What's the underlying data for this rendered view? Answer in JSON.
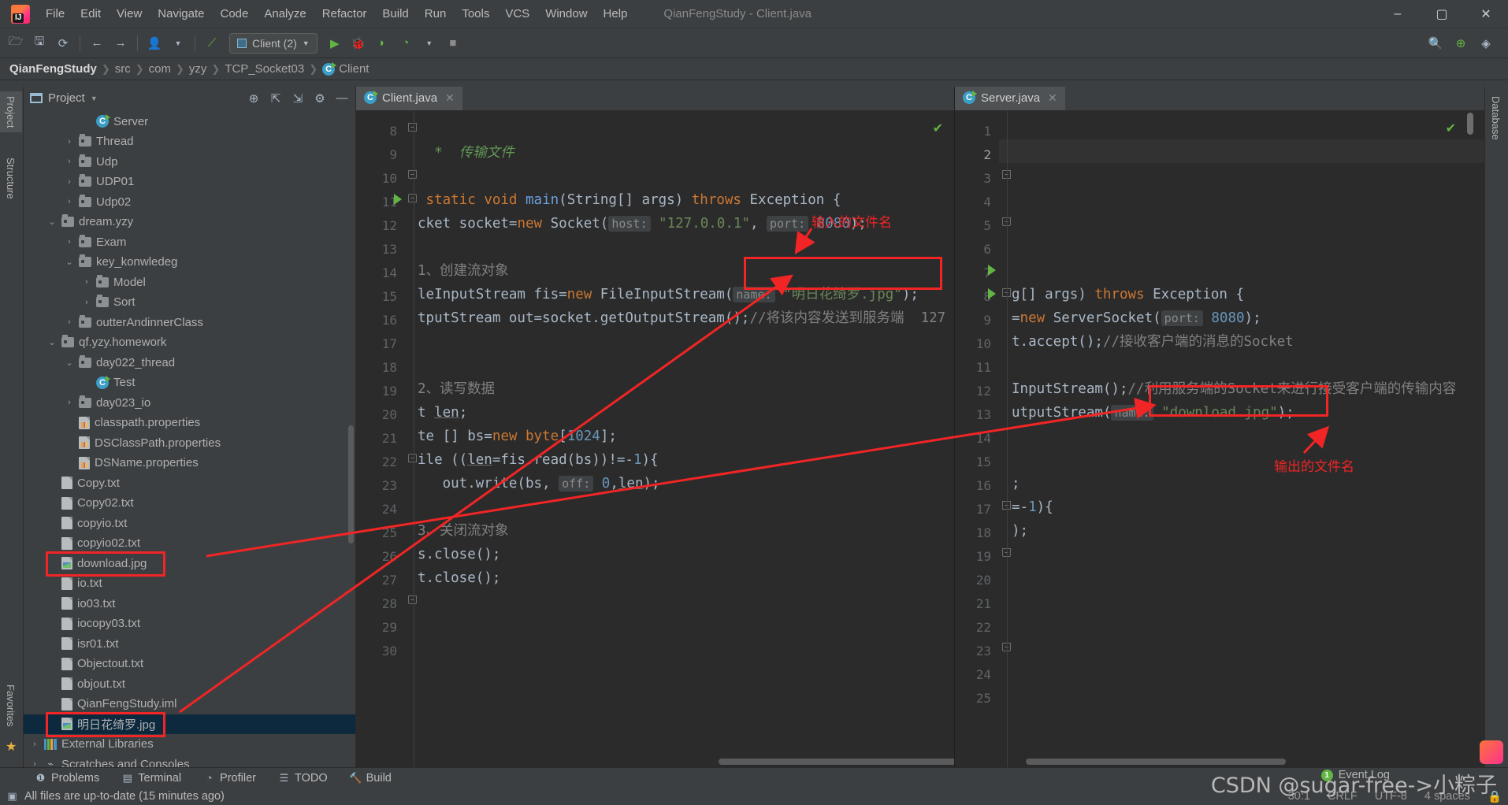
{
  "window": {
    "title": "QianFengStudy - Client.java",
    "minimize": "–",
    "maximize": "▢",
    "close": "✕"
  },
  "menu": {
    "items": [
      "File",
      "Edit",
      "View",
      "Navigate",
      "Code",
      "Analyze",
      "Refactor",
      "Build",
      "Run",
      "Tools",
      "VCS",
      "Window",
      "Help"
    ]
  },
  "toolbar": {
    "run_config": "Client (2)",
    "icons": [
      "open-folder-icon",
      "save-all-icon",
      "sync-icon",
      "back-icon",
      "forward-icon",
      "vcs-update-icon",
      "dropdown-icon",
      "make-project-icon",
      "run-icon",
      "debug-icon",
      "run-coverage-icon",
      "profiler-icon",
      "stop-icon",
      "search-everywhere-icon",
      "plugin-icon",
      "ide-icon"
    ]
  },
  "breadcrumb": {
    "items": [
      "QianFengStudy",
      "src",
      "com",
      "yzy",
      "TCP_Socket03",
      "Client"
    ],
    "separator": "❯"
  },
  "left_strip": {
    "tabs": [
      "Project",
      "Structure"
    ],
    "bottom": [
      "Favorites"
    ]
  },
  "right_strip": {
    "tabs": [
      "Database"
    ]
  },
  "project_panel": {
    "title": "Project",
    "header_icons": [
      "locate-icon",
      "expand-all-icon",
      "collapse-all-icon",
      "settings-icon",
      "hide-icon"
    ],
    "tree": [
      {
        "label": "Server",
        "indent": 3,
        "icon": "class-icon",
        "arrow": ""
      },
      {
        "label": "Thread",
        "indent": 2,
        "icon": "folder-icon",
        "arrow": "›"
      },
      {
        "label": "Udp",
        "indent": 2,
        "icon": "folder-icon",
        "arrow": "›"
      },
      {
        "label": "UDP01",
        "indent": 2,
        "icon": "folder-icon",
        "arrow": "›"
      },
      {
        "label": "Udp02",
        "indent": 2,
        "icon": "folder-icon",
        "arrow": "›"
      },
      {
        "label": "dream.yzy",
        "indent": 1,
        "icon": "folder-icon",
        "arrow": "⌄"
      },
      {
        "label": "Exam",
        "indent": 2,
        "icon": "folder-icon",
        "arrow": "›"
      },
      {
        "label": "key_konwledeg",
        "indent": 2,
        "icon": "folder-icon",
        "arrow": "⌄"
      },
      {
        "label": "Model",
        "indent": 3,
        "icon": "folder-icon",
        "arrow": "›"
      },
      {
        "label": "Sort",
        "indent": 3,
        "icon": "folder-icon",
        "arrow": "›"
      },
      {
        "label": "outterAndinnerClass",
        "indent": 2,
        "icon": "folder-icon",
        "arrow": "›"
      },
      {
        "label": "qf.yzy.homework",
        "indent": 1,
        "icon": "folder-icon",
        "arrow": "⌄"
      },
      {
        "label": "day022_thread",
        "indent": 2,
        "icon": "folder-icon",
        "arrow": "⌄"
      },
      {
        "label": "Test",
        "indent": 3,
        "icon": "class-icon",
        "arrow": ""
      },
      {
        "label": "day023_io",
        "indent": 2,
        "icon": "folder-icon",
        "arrow": "›"
      },
      {
        "label": "classpath.properties",
        "indent": 2,
        "icon": "properties-icon",
        "arrow": ""
      },
      {
        "label": "DSClassPath.properties",
        "indent": 2,
        "icon": "properties-icon",
        "arrow": ""
      },
      {
        "label": "DSName.properties",
        "indent": 2,
        "icon": "properties-icon",
        "arrow": ""
      },
      {
        "label": "Copy.txt",
        "indent": 1,
        "icon": "text-file-icon",
        "arrow": ""
      },
      {
        "label": "Copy02.txt",
        "indent": 1,
        "icon": "text-file-icon",
        "arrow": ""
      },
      {
        "label": "copyio.txt",
        "indent": 1,
        "icon": "text-file-icon",
        "arrow": ""
      },
      {
        "label": "copyio02.txt",
        "indent": 1,
        "icon": "text-file-icon",
        "arrow": ""
      },
      {
        "label": "download.jpg",
        "indent": 1,
        "icon": "image-file-icon",
        "arrow": "",
        "highlight": true
      },
      {
        "label": "io.txt",
        "indent": 1,
        "icon": "text-file-icon",
        "arrow": ""
      },
      {
        "label": "io03.txt",
        "indent": 1,
        "icon": "text-file-icon",
        "arrow": ""
      },
      {
        "label": "iocopy03.txt",
        "indent": 1,
        "icon": "text-file-icon",
        "arrow": ""
      },
      {
        "label": "isr01.txt",
        "indent": 1,
        "icon": "text-file-icon",
        "arrow": ""
      },
      {
        "label": "Objectout.txt",
        "indent": 1,
        "icon": "text-file-icon",
        "arrow": ""
      },
      {
        "label": "objout.txt",
        "indent": 1,
        "icon": "text-file-icon",
        "arrow": ""
      },
      {
        "label": "QianFengStudy.iml",
        "indent": 1,
        "icon": "module-file-icon",
        "arrow": ""
      },
      {
        "label": "明日花绮罗.jpg",
        "indent": 1,
        "icon": "image-file-icon",
        "arrow": "",
        "selected": true,
        "highlight": true
      },
      {
        "label": "External Libraries",
        "indent": 0,
        "icon": "library-icon",
        "arrow": "›"
      },
      {
        "label": "Scratches and Consoles",
        "indent": 0,
        "icon": "scratches-icon",
        "arrow": "›"
      }
    ]
  },
  "editor_left": {
    "tab": {
      "label": "Client.java",
      "icon": "class-icon",
      "close": "✕"
    },
    "lines": [
      {
        "n": 8,
        "text": "",
        "fold": "mid"
      },
      {
        "n": 9,
        "segs": [
          {
            "t": "  *  传输文件",
            "c": "cmt-doc"
          }
        ]
      },
      {
        "n": 10,
        "text": "",
        "fold": "end"
      },
      {
        "n": 11,
        "run": true,
        "fold": "start",
        "segs": [
          {
            "t": " ",
            "c": "plain"
          },
          {
            "t": "static",
            "c": "kw"
          },
          {
            "t": " ",
            "c": "plain"
          },
          {
            "t": "void",
            "c": "kw"
          },
          {
            "t": " ",
            "c": "plain"
          },
          {
            "t": "main",
            "c": "kw2"
          },
          {
            "t": "(String[] args) ",
            "c": "plain"
          },
          {
            "t": "throws",
            "c": "kw"
          },
          {
            "t": " Exception {",
            "c": "plain"
          }
        ]
      },
      {
        "n": 12,
        "segs": [
          {
            "t": "cket socket=",
            "c": "plain"
          },
          {
            "t": "new",
            "c": "kw"
          },
          {
            "t": " Socket(",
            "c": "plain"
          },
          {
            "t": "host:",
            "c": "hint"
          },
          {
            "t": " ",
            "c": "plain"
          },
          {
            "t": "\"127.0.0.1\"",
            "c": "str"
          },
          {
            "t": ", ",
            "c": "plain"
          },
          {
            "t": "port:",
            "c": "hint"
          },
          {
            "t": " ",
            "c": "plain"
          },
          {
            "t": "8080",
            "c": "num"
          },
          {
            "t": ");",
            "c": "plain"
          }
        ]
      },
      {
        "n": 13,
        "text": ""
      },
      {
        "n": 14,
        "segs": [
          {
            "t": "1、创建流对象",
            "c": "cmt"
          }
        ]
      },
      {
        "n": 15,
        "segs": [
          {
            "t": "leInputStream fis=",
            "c": "plain"
          },
          {
            "t": "new",
            "c": "kw"
          },
          {
            "t": " FileInputStream(",
            "c": "plain"
          },
          {
            "t": "name:",
            "c": "hint"
          },
          {
            "t": " ",
            "c": "plain"
          },
          {
            "t": "\"明日花绮罗.jpg\"",
            "c": "str"
          },
          {
            "t": ");",
            "c": "plain"
          }
        ]
      },
      {
        "n": 16,
        "segs": [
          {
            "t": "tputStream out=socket.getOutputStream();",
            "c": "plain"
          },
          {
            "t": "//将该内容发送到服务端  127",
            "c": "cmt"
          }
        ]
      },
      {
        "n": 17,
        "text": ""
      },
      {
        "n": 18,
        "text": ""
      },
      {
        "n": 19,
        "segs": [
          {
            "t": "2、读写数据",
            "c": "cmt"
          }
        ]
      },
      {
        "n": 20,
        "segs": [
          {
            "t": "t ",
            "c": "plain"
          },
          {
            "t": "len",
            "c": "ident"
          },
          {
            "t": ";",
            "c": "plain"
          }
        ]
      },
      {
        "n": 21,
        "segs": [
          {
            "t": "te [] bs=",
            "c": "plain"
          },
          {
            "t": "new",
            "c": "kw"
          },
          {
            "t": " ",
            "c": "plain"
          },
          {
            "t": "byte",
            "c": "kw"
          },
          {
            "t": "[",
            "c": "plain"
          },
          {
            "t": "1024",
            "c": "num"
          },
          {
            "t": "];",
            "c": "plain"
          }
        ]
      },
      {
        "n": 22,
        "fold": "start",
        "segs": [
          {
            "t": "ile ((",
            "c": "plain"
          },
          {
            "t": "len",
            "c": "ident"
          },
          {
            "t": "=fis.read(bs))!=-",
            "c": "plain"
          },
          {
            "t": "1",
            "c": "num"
          },
          {
            "t": "){",
            "c": "plain"
          }
        ]
      },
      {
        "n": 23,
        "segs": [
          {
            "t": "   out.write(bs, ",
            "c": "plain"
          },
          {
            "t": "off:",
            "c": "hint"
          },
          {
            "t": " ",
            "c": "plain"
          },
          {
            "t": "0",
            "c": "num"
          },
          {
            "t": ",",
            "c": "plain"
          },
          {
            "t": "len",
            "c": "ident"
          },
          {
            "t": ");",
            "c": "plain"
          }
        ]
      },
      {
        "n": 24,
        "text": ""
      },
      {
        "n": 25,
        "segs": [
          {
            "t": "3、关闭流对象",
            "c": "cmt"
          }
        ]
      },
      {
        "n": 26,
        "segs": [
          {
            "t": "s.close();",
            "c": "plain"
          }
        ]
      },
      {
        "n": 27,
        "segs": [
          {
            "t": "t.close();",
            "c": "plain"
          }
        ]
      },
      {
        "n": 28,
        "text": "",
        "fold": "end"
      },
      {
        "n": 29,
        "text": ""
      },
      {
        "n": 30,
        "text": ""
      }
    ]
  },
  "editor_right": {
    "tab": {
      "label": "Server.java",
      "icon": "class-icon",
      "close": "✕"
    },
    "lines": [
      {
        "n": 1,
        "text": ""
      },
      {
        "n": 2,
        "text": "",
        "current": true
      },
      {
        "n": 3,
        "text": "",
        "fold": "mid"
      },
      {
        "n": 4,
        "text": ""
      },
      {
        "n": 5,
        "text": "",
        "fold": "end"
      },
      {
        "n": 6,
        "text": ""
      },
      {
        "n": 7,
        "run": true,
        "text": ""
      },
      {
        "n": 8,
        "run": true,
        "fold": "mid",
        "segs": [
          {
            "t": "g[] args) ",
            "c": "plain"
          },
          {
            "t": "throws",
            "c": "kw"
          },
          {
            "t": " Exception {",
            "c": "plain"
          }
        ]
      },
      {
        "n": 9,
        "segs": [
          {
            "t": "=",
            "c": "plain"
          },
          {
            "t": "new",
            "c": "kw"
          },
          {
            "t": " ServerSocket(",
            "c": "plain"
          },
          {
            "t": "port:",
            "c": "hint"
          },
          {
            "t": " ",
            "c": "plain"
          },
          {
            "t": "8080",
            "c": "num"
          },
          {
            "t": ");",
            "c": "plain"
          }
        ]
      },
      {
        "n": 10,
        "segs": [
          {
            "t": "t.accept();",
            "c": "plain"
          },
          {
            "t": "//接收客户端的消息的Socket",
            "c": "cmt"
          }
        ]
      },
      {
        "n": 11,
        "text": ""
      },
      {
        "n": 12,
        "segs": [
          {
            "t": "InputStream();",
            "c": "plain"
          },
          {
            "t": "//利用服务端的Socket来进行接受客户端的传输内容",
            "c": "cmt"
          }
        ]
      },
      {
        "n": 13,
        "segs": [
          {
            "t": "utputStream(",
            "c": "plain"
          },
          {
            "t": "name:",
            "c": "hint"
          },
          {
            "t": " ",
            "c": "plain"
          },
          {
            "t": "\"download.jpg\"",
            "c": "str"
          },
          {
            "t": ");",
            "c": "plain"
          }
        ]
      },
      {
        "n": 14,
        "text": ""
      },
      {
        "n": 15,
        "text": ""
      },
      {
        "n": 16,
        "segs": [
          {
            "t": ";",
            "c": "plain"
          }
        ]
      },
      {
        "n": 17,
        "fold": "mid",
        "segs": [
          {
            "t": "=-",
            "c": "plain"
          },
          {
            "t": "1",
            "c": "num"
          },
          {
            "t": "){",
            "c": "plain"
          }
        ]
      },
      {
        "n": 18,
        "segs": [
          {
            "t": ");",
            "c": "plain"
          }
        ]
      },
      {
        "n": 19,
        "text": "",
        "fold": "end"
      },
      {
        "n": 20,
        "text": ""
      },
      {
        "n": 21,
        "text": ""
      },
      {
        "n": 22,
        "text": ""
      },
      {
        "n": 23,
        "text": "",
        "fold": "end"
      },
      {
        "n": 24,
        "text": ""
      },
      {
        "n": 25,
        "text": ""
      }
    ]
  },
  "annotations": {
    "input_label": "输入的文件名",
    "output_label": "输出的文件名"
  },
  "bottom_bar": {
    "items": [
      {
        "label": "Problems",
        "icon": "problems-icon"
      },
      {
        "label": "Terminal",
        "icon": "terminal-icon"
      },
      {
        "label": "Profiler",
        "icon": "profiler-icon"
      },
      {
        "label": "TODO",
        "icon": "todo-icon"
      },
      {
        "label": "Build",
        "icon": "build-icon"
      }
    ]
  },
  "status_bar": {
    "message": "All files are up-to-date (15 minutes ago)",
    "event_log": "Event Log",
    "event_count": "1",
    "caret": "30:1",
    "line_sep": "CRLF",
    "encoding": "UTF-8",
    "indent": "4 spaces",
    "lock_icon": "lock-icon"
  },
  "watermark": "CSDN @sugar-free->小粽子",
  "colors": {
    "accent_red": "#f12525",
    "selection": "#0d293e",
    "panel_bg": "#3c3f41",
    "editor_bg": "#2b2b2b",
    "green": "#62b543"
  }
}
